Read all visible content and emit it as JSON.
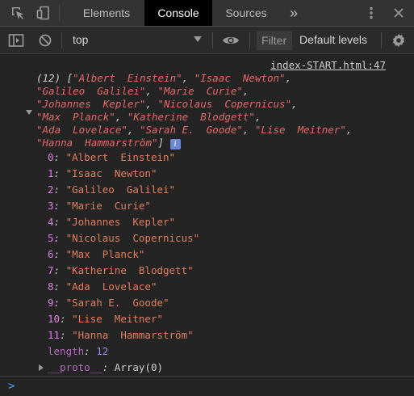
{
  "tabs": {
    "elements": "Elements",
    "console": "Console",
    "sources": "Sources",
    "more": "»"
  },
  "toolbar": {
    "context": "top",
    "filter_placeholder": "Filter",
    "levels": "Default levels"
  },
  "log": {
    "source": "index-START.html:47",
    "preview_lines": [
      {
        "count": "(12)",
        "bracket": "[",
        "items": [
          "\"Albert  Einstein\"",
          "\"Isaac  Newton\""
        ]
      },
      {
        "items": [
          "\"Galileo  Galilei\"",
          "\"Marie  Curie\""
        ]
      },
      {
        "items": [
          "\"Johannes  Kepler\"",
          "\"Nicolaus  Copernicus\""
        ]
      },
      {
        "items": [
          "\"Max  Planck\"",
          "\"Katherine  Blodgett\""
        ]
      },
      {
        "items": [
          "\"Ada  Lovelace\"",
          "\"Sarah E.  Goode\"",
          "\"Lise  Meitner\""
        ]
      },
      {
        "items": [
          "\"Hanna  Hammarström\""
        ],
        "close": "]"
      }
    ],
    "entries": [
      {
        "key": "0",
        "value": "\"Albert  Einstein\""
      },
      {
        "key": "1",
        "value": "\"Isaac  Newton\""
      },
      {
        "key": "2",
        "value": "\"Galileo  Galilei\""
      },
      {
        "key": "3",
        "value": "\"Marie  Curie\""
      },
      {
        "key": "4",
        "value": "\"Johannes  Kepler\""
      },
      {
        "key": "5",
        "value": "\"Nicolaus  Copernicus\""
      },
      {
        "key": "6",
        "value": "\"Max  Planck\""
      },
      {
        "key": "7",
        "value": "\"Katherine  Blodgett\""
      },
      {
        "key": "8",
        "value": "\"Ada  Lovelace\""
      },
      {
        "key": "9",
        "value": "\"Sarah E.  Goode\""
      },
      {
        "key": "10",
        "value": "\"Lise  Meitner\""
      },
      {
        "key": "11",
        "value": "\"Hanna  Hammarström\""
      }
    ],
    "length_key": "length",
    "length_value": "12",
    "proto_key": "__proto__",
    "proto_value": "Array(0)",
    "info_glyph": "i"
  },
  "prompt": ">",
  "colors": {
    "active_tab": "#000000",
    "string": "#e46a6a",
    "index": "#e07fe9",
    "info_badge": "#6f88d6",
    "prompt": "#4aa3ff"
  }
}
